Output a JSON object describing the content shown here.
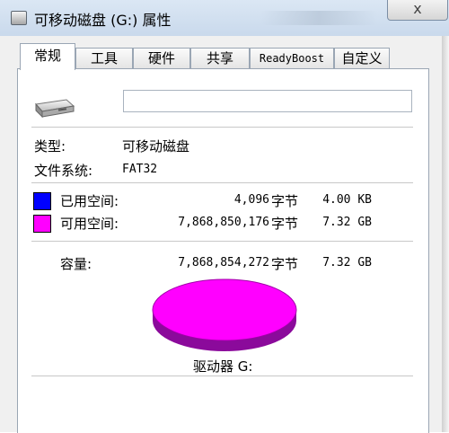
{
  "window": {
    "title": "可移动磁盘 (G:) 属性",
    "close_label": "x"
  },
  "tabs": [
    {
      "label": "常规",
      "active": true
    },
    {
      "label": "工具"
    },
    {
      "label": "硬件"
    },
    {
      "label": "共享"
    },
    {
      "label": "ReadyBoost"
    },
    {
      "label": "自定义"
    }
  ],
  "general": {
    "icon": "usb-drive-icon",
    "name_value": "",
    "type_label": "类型:",
    "type_value": "可移动磁盘",
    "fs_label": "文件系统:",
    "fs_value": "FAT32",
    "used": {
      "label": "已用空间:",
      "bytes": "4,096",
      "unit": "字节",
      "size": "4.00 KB",
      "color": "#0000ff"
    },
    "free": {
      "label": "可用空间:",
      "bytes": "7,868,850,176",
      "unit": "字节",
      "size": "7.32 GB",
      "color": "#ff00ff"
    },
    "capacity": {
      "label": "容量:",
      "bytes": "7,868,854,272",
      "unit": "字节",
      "size": "7.32 GB"
    },
    "drive_label": "驱动器 G:"
  },
  "colors": {
    "pie_top": "#ff00ff",
    "pie_side": "#8b0a9b",
    "used_swatch": "#0000ff"
  }
}
